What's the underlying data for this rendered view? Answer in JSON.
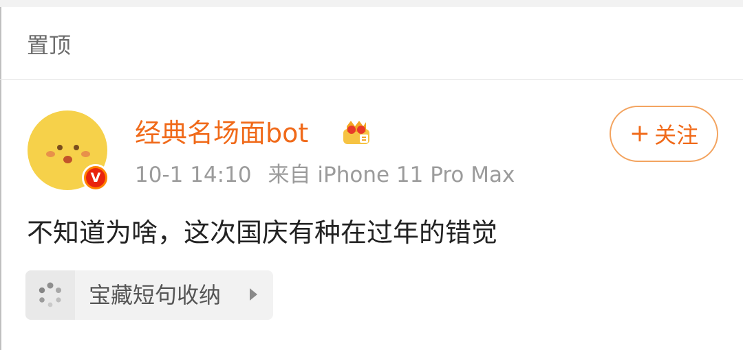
{
  "section": {
    "title": "置顶"
  },
  "post": {
    "username": "经典名场面bot",
    "timestamp": "10-1 14:10",
    "source": "来自 iPhone 11 Pro Max",
    "text": "不知道为啥，这次国庆有种在过年的错觉",
    "follow_button": {
      "plus": "+",
      "label": "关注"
    },
    "verified_badge": "V",
    "vip_icon": "crown-icon",
    "topic": {
      "label": "宝藏短句收纳",
      "icon": "loading-dots-icon"
    }
  },
  "colors": {
    "accent": "#f06a1a",
    "badge": "#e9230e",
    "meta": "#9b9b9b"
  }
}
